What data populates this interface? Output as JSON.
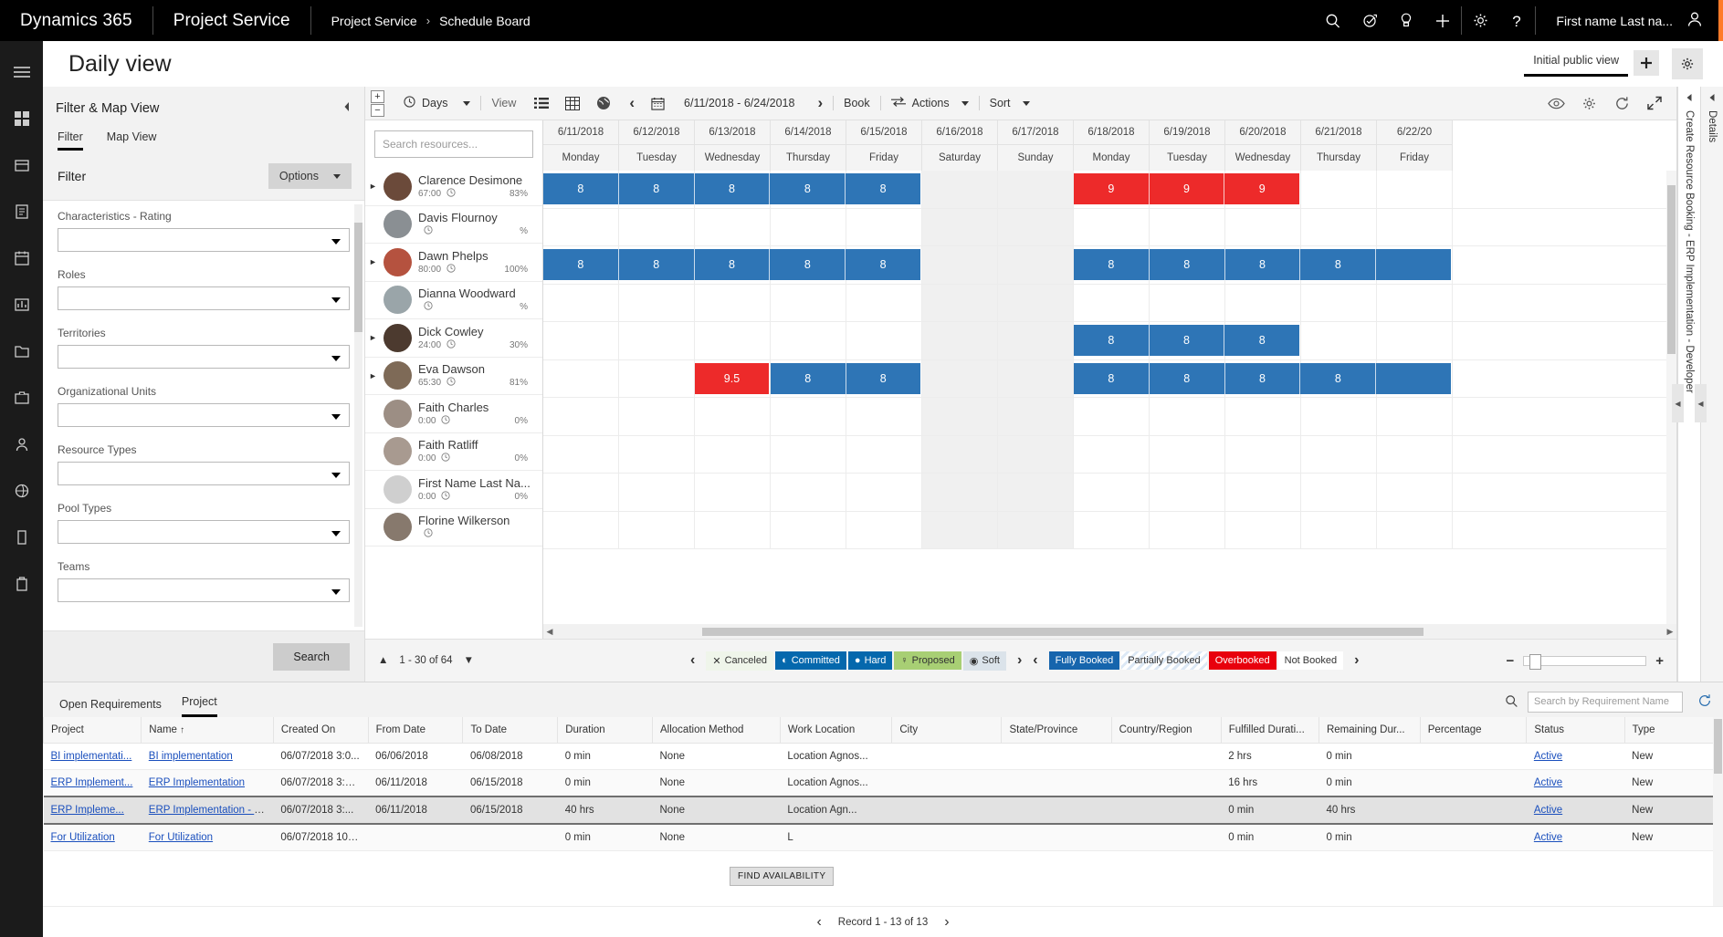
{
  "topnav": {
    "brand": "Dynamics 365",
    "app": "Project Service",
    "breadcrumb_root": "Project Service",
    "breadcrumb_sep": "›",
    "breadcrumb_current": "Schedule Board",
    "icons": [
      "search-icon",
      "assistant-icon",
      "lightbulb-icon",
      "plus-icon",
      "gear-icon",
      "help-icon"
    ],
    "user_name": "First name Last na...",
    "accent_color": "#ff7a29"
  },
  "rail": {
    "items": [
      "hamburger-menu-icon",
      "dashboard-icon",
      "clients-icon",
      "documents-icon",
      "calendar-icon",
      "reports-icon",
      "files-icon",
      "briefcase-icon",
      "person-icon",
      "network-icon",
      "device-icon",
      "resource-icon"
    ]
  },
  "page": {
    "title": "Daily view",
    "view_name": "Initial public view",
    "add_view_label": "+",
    "settings_label": "⚙"
  },
  "filter_panel": {
    "title": "Filter & Map View",
    "collapse_icon": "collapse-left-icon",
    "tabs": [
      {
        "label": "Filter",
        "active": true
      },
      {
        "label": "Map View",
        "active": false
      }
    ],
    "section_label": "Filter",
    "options_button": "Options",
    "fields": [
      {
        "label": "Characteristics - Rating",
        "value": ""
      },
      {
        "label": "Roles",
        "value": ""
      },
      {
        "label": "Territories",
        "value": ""
      },
      {
        "label": "Organizational Units",
        "value": ""
      },
      {
        "label": "Resource Types",
        "value": ""
      },
      {
        "label": "Pool Types",
        "value": ""
      },
      {
        "label": "Teams",
        "value": ""
      }
    ],
    "search_button": "Search"
  },
  "board_toolbar": {
    "zoom_in": "+",
    "zoom_out": "−",
    "scale_label": "Days",
    "view_label": "View",
    "view_icons": [
      "list-view-icon",
      "grid-view-icon",
      "map-view-icon"
    ],
    "prev_label": "‹",
    "date_range": "6/11/2018 - 6/24/2018",
    "next_label": "›",
    "book_label": "Book",
    "actions_label": "Actions",
    "sort_label": "Sort",
    "right_icons": [
      "eye-icon",
      "gear-icon",
      "refresh-icon",
      "fullscreen-icon"
    ]
  },
  "resources": {
    "search_placeholder": "Search resources...",
    "items": [
      {
        "name": "Clarence Desimone",
        "hours": "67:00",
        "percent": "83%",
        "expandable": true,
        "avatar": "#6b4a3a"
      },
      {
        "name": "Davis Flournoy",
        "hours": "",
        "percent": "%",
        "expandable": false,
        "avatar": "#8a8f93"
      },
      {
        "name": "Dawn Phelps",
        "hours": "80:00",
        "percent": "100%",
        "expandable": true,
        "avatar": "#b5523f"
      },
      {
        "name": "Dianna Woodward",
        "hours": "",
        "percent": "%",
        "expandable": false,
        "avatar": "#9aa5a9"
      },
      {
        "name": "Dick Cowley",
        "hours": "24:00",
        "percent": "30%",
        "expandable": true,
        "avatar": "#4c3a2f"
      },
      {
        "name": "Eva Dawson",
        "hours": "65:30",
        "percent": "81%",
        "expandable": true,
        "avatar": "#7e6a57"
      },
      {
        "name": "Faith Charles",
        "hours": "0:00",
        "percent": "0%",
        "expandable": false,
        "avatar": "#9c8e84"
      },
      {
        "name": "Faith Ratliff",
        "hours": "0:00",
        "percent": "0%",
        "expandable": false,
        "avatar": "#a89a90"
      },
      {
        "name": "First Name Last Na...",
        "hours": "0:00",
        "percent": "0%",
        "expandable": false,
        "avatar": "#cfcfcf"
      },
      {
        "name": "Florine Wilkerson",
        "hours": "",
        "percent": "",
        "expandable": false,
        "avatar": "#87796d"
      }
    ]
  },
  "grid": {
    "columns": [
      {
        "date": "6/11/2018",
        "day": "Monday",
        "weekend": false
      },
      {
        "date": "6/12/2018",
        "day": "Tuesday",
        "weekend": false
      },
      {
        "date": "6/13/2018",
        "day": "Wednesday",
        "weekend": false
      },
      {
        "date": "6/14/2018",
        "day": "Thursday",
        "weekend": false
      },
      {
        "date": "6/15/2018",
        "day": "Friday",
        "weekend": false
      },
      {
        "date": "6/16/2018",
        "day": "Saturday",
        "weekend": true
      },
      {
        "date": "6/17/2018",
        "day": "Sunday",
        "weekend": true
      },
      {
        "date": "6/18/2018",
        "day": "Monday",
        "weekend": false
      },
      {
        "date": "6/19/2018",
        "day": "Tuesday",
        "weekend": false
      },
      {
        "date": "6/20/2018",
        "day": "Wednesday",
        "weekend": false
      },
      {
        "date": "6/21/2018",
        "day": "Thursday",
        "weekend": false
      },
      {
        "date": "6/22/20",
        "day": "Friday",
        "weekend": false
      }
    ],
    "bookings": [
      {
        "row": 0,
        "start": 0,
        "span": 5,
        "values": [
          "8",
          "8",
          "8",
          "8",
          "8"
        ],
        "status": "blue"
      },
      {
        "row": 0,
        "start": 7,
        "span": 3,
        "values": [
          "9",
          "9",
          "9"
        ],
        "status": "red"
      },
      {
        "row": 2,
        "start": 0,
        "span": 5,
        "values": [
          "8",
          "8",
          "8",
          "8",
          "8"
        ],
        "status": "blue"
      },
      {
        "row": 2,
        "start": 7,
        "span": 5,
        "values": [
          "8",
          "8",
          "8",
          "8",
          ""
        ],
        "status": "blue"
      },
      {
        "row": 4,
        "start": 7,
        "span": 3,
        "values": [
          "8",
          "8",
          "8"
        ],
        "status": "blue"
      },
      {
        "row": 5,
        "start": 2,
        "span": 1,
        "values": [
          "9.5"
        ],
        "status": "red"
      },
      {
        "row": 5,
        "start": 3,
        "span": 2,
        "values": [
          "8",
          "8"
        ],
        "status": "blue"
      },
      {
        "row": 5,
        "start": 7,
        "span": 5,
        "values": [
          "8",
          "8",
          "8",
          "8",
          ""
        ],
        "status": "blue"
      }
    ],
    "colors": {
      "fully_booked": "#2e75b6",
      "overbooked": "#ed2a2a",
      "weekend": "#f0f0f0"
    }
  },
  "board_footer": {
    "page_range": "1 - 30 of 64",
    "up_icon": "chevron-up-icon",
    "down_icon": "chevron-down-icon",
    "booking_status_legend": [
      {
        "label": "Canceled",
        "bg": "#eff5ea",
        "fg": "#333333",
        "glyph": "✕"
      },
      {
        "label": "Committed",
        "bg": "#0568ad",
        "fg": "#ffffff",
        "glyph": "◐"
      },
      {
        "label": "Hard",
        "bg": "#0568ad",
        "fg": "#ffffff",
        "glyph": "●"
      },
      {
        "label": "Proposed",
        "bg": "#a8cf74",
        "fg": "#333333",
        "glyph": "♀"
      },
      {
        "label": "Soft",
        "bg": "#dbe3ea",
        "fg": "#333333",
        "glyph": "◉"
      }
    ],
    "availability_legend": [
      {
        "label": "Fully Booked",
        "bg": "#1665ad",
        "fg": "#ffffff"
      },
      {
        "label": "Partially Booked",
        "bg": "#ffffff",
        "fg": "#333333"
      },
      {
        "label": "Overbooked",
        "bg": "#e8000d",
        "fg": "#ffffff"
      },
      {
        "label": "Not Booked",
        "bg": "#ffffff",
        "fg": "#333333"
      }
    ],
    "prev_icon": "chevron-left-icon",
    "next_icon": "chevron-right-icon",
    "zoom_out": "−",
    "zoom_in": "+"
  },
  "side_panels": {
    "booking_panel": "Create Resource Booking - ERP Implementation - Developer",
    "details_panel": "Details"
  },
  "bottom": {
    "tabs": [
      {
        "label": "Open Requirements",
        "active": false
      },
      {
        "label": "Project",
        "active": true
      }
    ],
    "search_placeholder": "Search by Requirement Name",
    "search_icon": "search-icon",
    "refresh_icon": "refresh-icon",
    "columns": [
      "Project",
      "Name",
      "Created On",
      "From Date",
      "To Date",
      "Duration",
      "Allocation Method",
      "Work Location",
      "City",
      "State/Province",
      "Country/Region",
      "Fulfilled Durati...",
      "Remaining Dur...",
      "Percentage",
      "Status",
      "Type"
    ],
    "sorted_column": "Name",
    "sort_glyph": "↑",
    "rows": [
      {
        "selected": false,
        "cells": [
          "BI implementati...",
          "BI implementation",
          "06/07/2018 3:0...",
          "06/06/2018",
          "06/08/2018",
          "0 min",
          "None",
          "Location Agnos...",
          "",
          "",
          "",
          "2 hrs",
          "0 min",
          "",
          "Active",
          "New"
        ]
      },
      {
        "selected": false,
        "cells": [
          "ERP Implement...",
          "ERP Implementation",
          "06/07/2018 3:01...",
          "06/11/2018",
          "06/15/2018",
          "0 min",
          "None",
          "Location Agnos...",
          "",
          "",
          "",
          "16 hrs",
          "0 min",
          "",
          "Active",
          "New"
        ]
      },
      {
        "selected": true,
        "cells": [
          "ERP Impleme...",
          "ERP Implementation - D...",
          "06/07/2018 3:...",
          "06/11/2018",
          "06/15/2018",
          "40 hrs",
          "None",
          "Location Agn...",
          "",
          "",
          "",
          "0 min",
          "40 hrs",
          "",
          "Active",
          "New"
        ]
      },
      {
        "selected": false,
        "cells": [
          "For Utilization",
          "For Utilization",
          "06/07/2018 10:3...",
          "",
          "",
          "0 min",
          "None",
          "L",
          "",
          "",
          "",
          "0 min",
          "0 min",
          "",
          "Active",
          "New"
        ]
      }
    ],
    "tooltip": "FIND AVAILABILITY",
    "record_prev": "‹",
    "record_label": "Record 1 - 13 of 13",
    "record_next": "›"
  }
}
